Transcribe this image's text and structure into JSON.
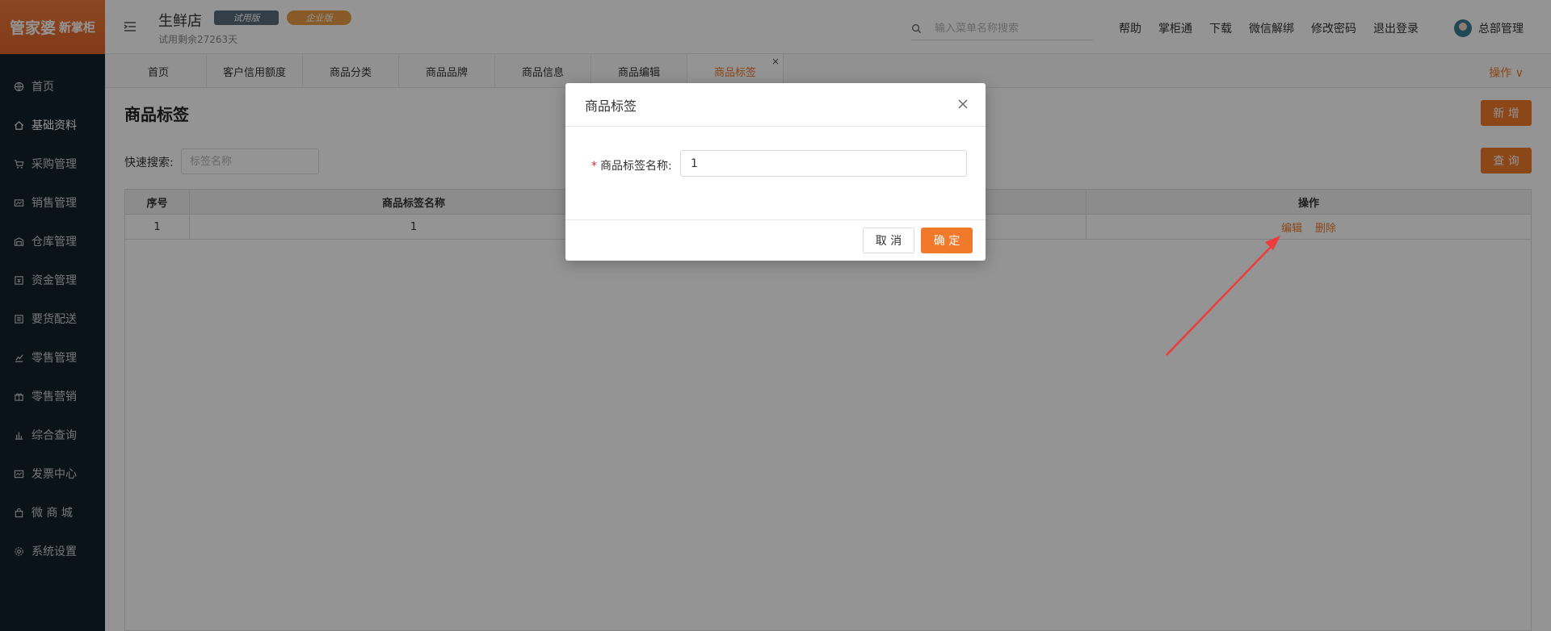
{
  "logo": {
    "text": "管家婆",
    "sub": "新掌柜"
  },
  "sidebar": {
    "items": [
      {
        "label": "首页",
        "icon": "globe-icon"
      },
      {
        "label": "基础资料",
        "icon": "home-icon"
      },
      {
        "label": "采购管理",
        "icon": "cart-icon"
      },
      {
        "label": "销售管理",
        "icon": "sales-icon"
      },
      {
        "label": "仓库管理",
        "icon": "warehouse-icon"
      },
      {
        "label": "资金管理",
        "icon": "wallet-icon"
      },
      {
        "label": "要货配送",
        "icon": "list-icon"
      },
      {
        "label": "零售管理",
        "icon": "chart-icon"
      },
      {
        "label": "零售营销",
        "icon": "gift-icon"
      },
      {
        "label": "综合查询",
        "icon": "bar-chart-icon"
      },
      {
        "label": "发票中心",
        "icon": "invoice-icon"
      },
      {
        "label": "微 商 城",
        "icon": "bag-icon"
      },
      {
        "label": "系统设置",
        "icon": "gear-icon"
      }
    ],
    "active_index": 1
  },
  "header": {
    "store_name": "生鲜店",
    "badge_trial": "试用版",
    "badge_enterprise": "企业版",
    "trial_remaining": "试用剩余27263天",
    "search_placeholder": "输入菜单名称搜索",
    "links": [
      "帮助",
      "掌柜通",
      "下载",
      "微信解绑",
      "修改密码",
      "退出登录"
    ],
    "user_name": "总部管理"
  },
  "tabs": {
    "items": [
      "首页",
      "客户信用额度",
      "商品分类",
      "商品品牌",
      "商品信息",
      "商品编辑",
      "商品标签"
    ],
    "active_index": 6,
    "close_glyph": "×",
    "ops_label": "操作 ∨"
  },
  "page": {
    "title": "商品标签",
    "add_button": "新 增",
    "query_button": "查 询",
    "quick_search_label": "快速搜索:",
    "quick_search_placeholder": "标签名称"
  },
  "grid": {
    "columns": [
      "序号",
      "商品标签名称",
      "",
      "操作"
    ],
    "rows": [
      {
        "index": "1",
        "name": "1",
        "extra": ""
      }
    ],
    "edit_label": "编辑",
    "delete_label": "删除"
  },
  "modal": {
    "title": "商品标签",
    "field_required_mark": "*",
    "field_label": "商品标签名称:",
    "field_value": "1",
    "cancel_label": "取 消",
    "ok_label": "确 定"
  },
  "colors": {
    "accent": "#f07a2a",
    "sidebar_bg": "#12202d",
    "arrow": "#ee3b3b"
  }
}
